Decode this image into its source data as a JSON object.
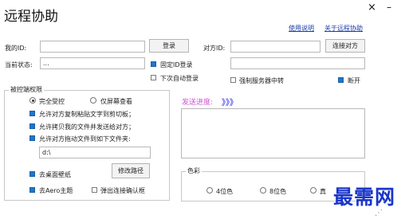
{
  "window": {
    "title": "远程协助",
    "close_glyph": "×",
    "minimize_glyph": "–"
  },
  "links": {
    "help": "使用说明",
    "about": "关于远程协助"
  },
  "my_id": {
    "label": "我的ID:",
    "value": ""
  },
  "register_button": "登录",
  "peer_id": {
    "label": "对方ID:",
    "value": ""
  },
  "connect_button": "连接对方",
  "status": {
    "label": "当前状态:",
    "value": "..."
  },
  "fixed_id_login": {
    "label": "固定ID登录",
    "checked": true
  },
  "auto_login": {
    "label": "下次自动登录",
    "checked": false
  },
  "peer_field2": {
    "value": ""
  },
  "force_relay": {
    "label": "强制服务器中转",
    "checked": false
  },
  "disconnect": {
    "label": "断开",
    "checked": true
  },
  "permissions": {
    "legend": "被控端权限",
    "full_control": "完全受控",
    "view_only": "仅屏幕查看",
    "selected": "full_control",
    "allow_clipboard": {
      "label": "允许对方复制粘贴文字到剪切板；",
      "checked": true
    },
    "allow_send_files": {
      "label": "允许拷贝我的文件并发送给对方；",
      "checked": true
    },
    "allow_drag_files": {
      "label": "允许对方拖动文件到如下文件夹:",
      "checked": true
    },
    "folder_path": "d:\\",
    "remove_wallpaper": {
      "label": "去桌面壁纸",
      "checked": true
    },
    "modify_path_button": "修改路径",
    "remove_aero": {
      "label": "去Aero主题",
      "checked": true
    },
    "popup_confirm": {
      "label": "弹出连接确认框",
      "checked": false
    }
  },
  "send_progress": {
    "label": "发送进度:",
    "arrows": "》》》"
  },
  "color": {
    "legend": "色彩",
    "options": [
      "4位色",
      "8位色",
      "真"
    ],
    "selected": null
  },
  "watermark": {
    "text": "最需网",
    "corner_glyph": "⋰"
  },
  "colors": {
    "accent_blue": "#1e77c9",
    "link_blue": "#1a3fa8",
    "progress_magenta": "#d24fd8",
    "watermark_blue": "#1a36c8"
  }
}
